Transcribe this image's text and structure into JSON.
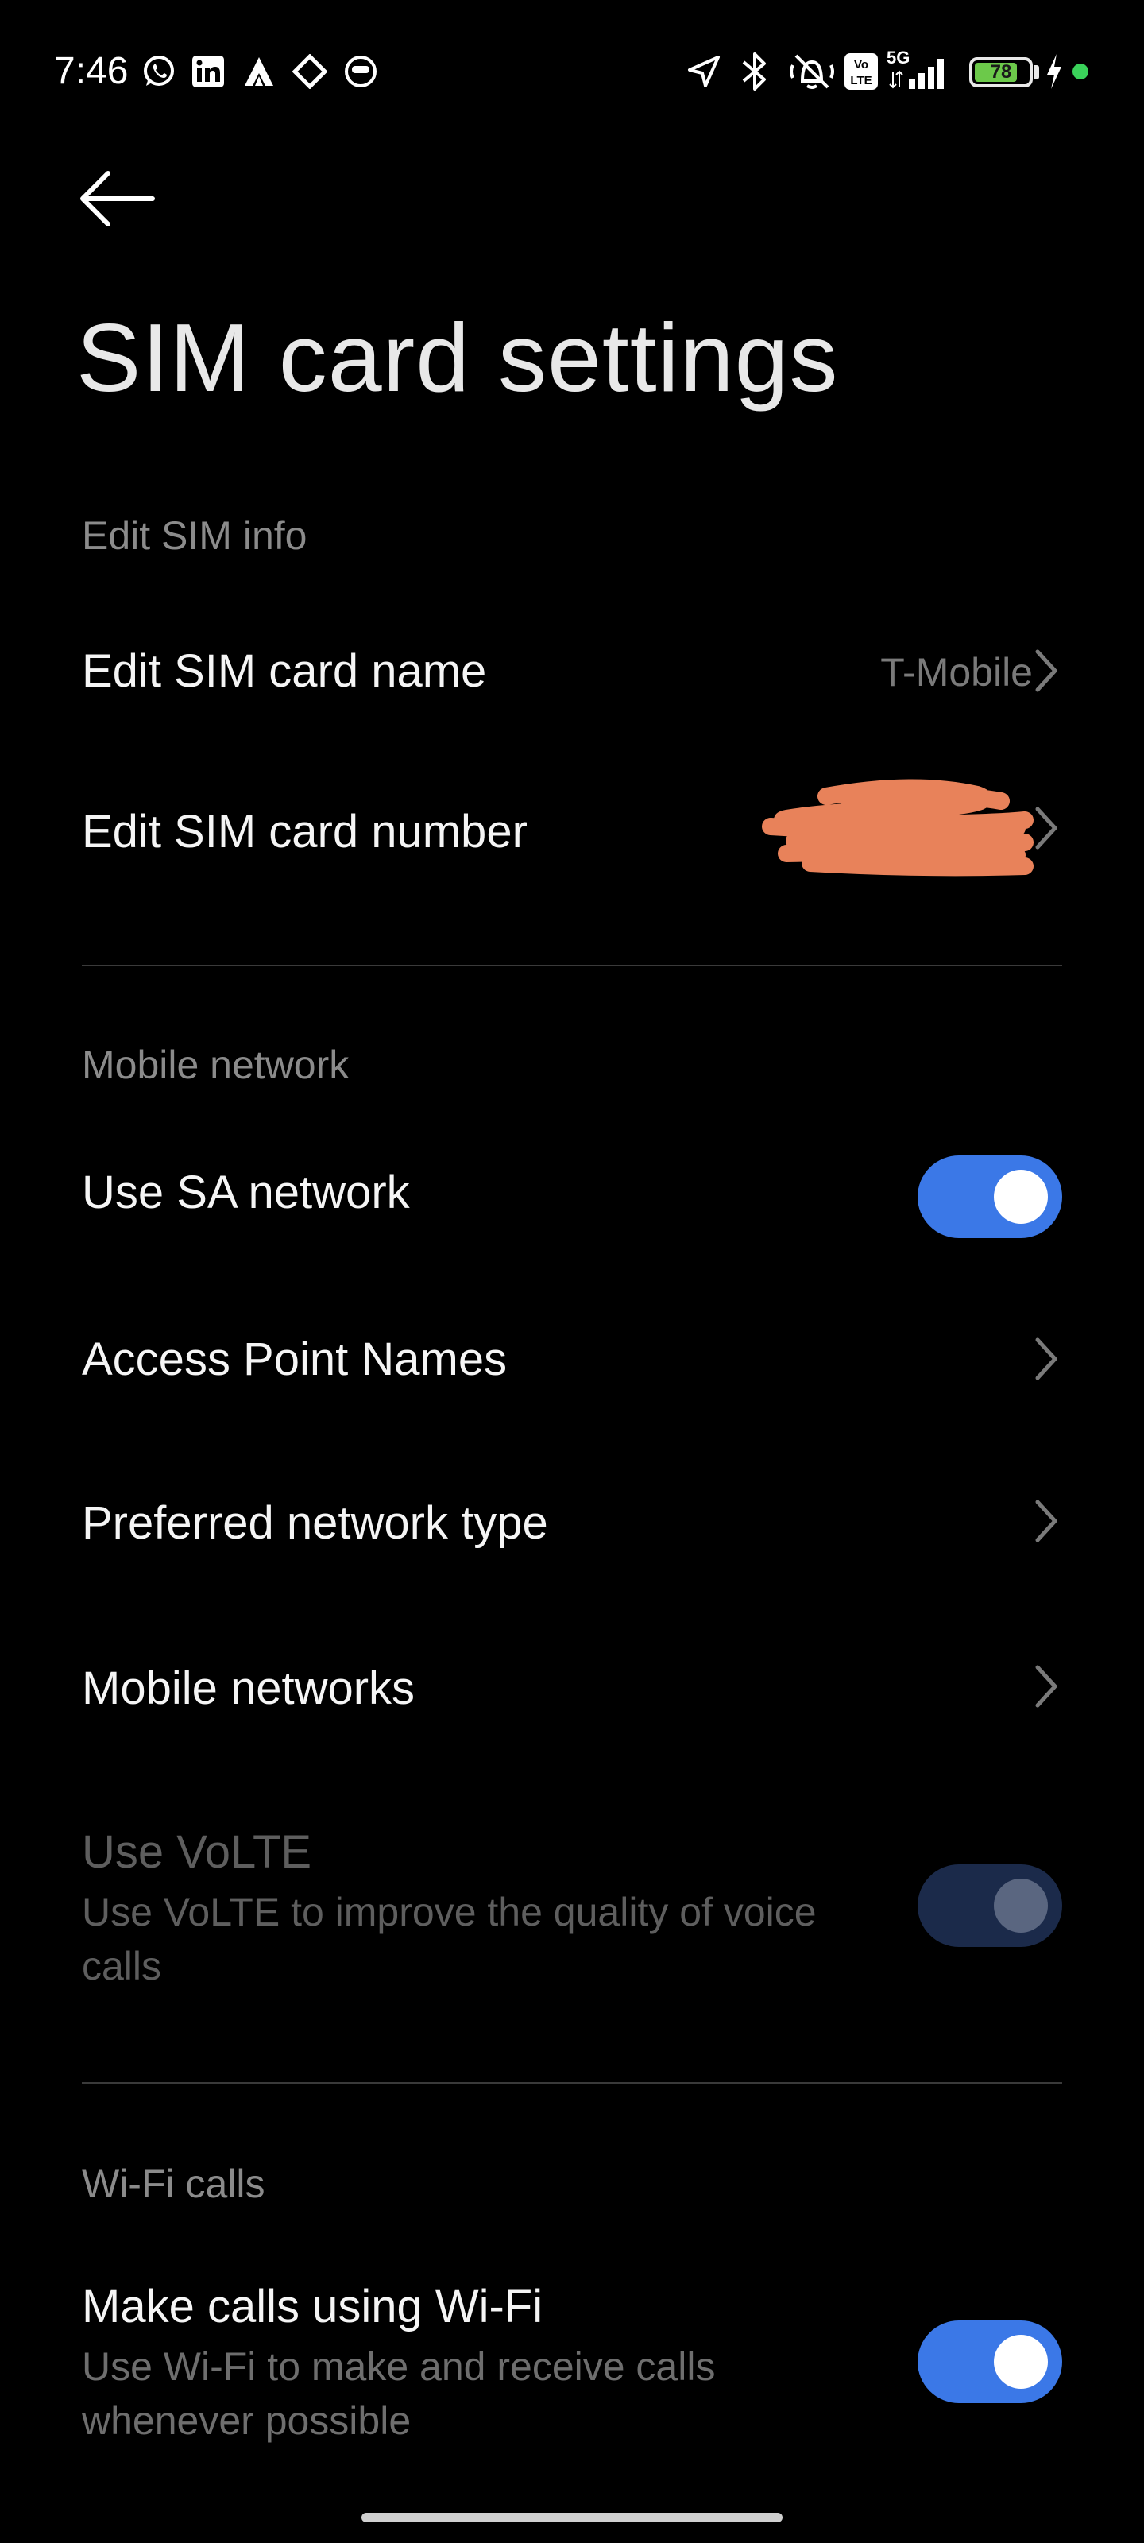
{
  "status_bar": {
    "time": "7:46",
    "left_icons": [
      "whatsapp-icon",
      "linkedin-icon",
      "app-triangle-icon",
      "app-diamond-icon",
      "app-face-icon"
    ],
    "right_icons": [
      "location-arrow-icon",
      "bluetooth-icon",
      "vibrate-mute-icon",
      "volte-icon",
      "signal-5g-icon",
      "battery-icon",
      "charging-icon"
    ],
    "network": "5G",
    "volte_badge": "Vo LTE",
    "battery_level": "78",
    "battery_color": "#6cc94a",
    "dot_color": "#3ad25a"
  },
  "header": {
    "title": "SIM card settings"
  },
  "sections": {
    "edit_sim_info": {
      "header": "Edit SIM info",
      "name_row": {
        "title": "Edit SIM card name",
        "value": "T-Mobile"
      },
      "number_row": {
        "title": "Edit SIM card number"
      }
    },
    "mobile_network": {
      "header": "Mobile network",
      "sa_network": {
        "title": "Use SA network",
        "enabled": true
      },
      "apn": {
        "title": "Access Point Names"
      },
      "preferred_type": {
        "title": "Preferred network type"
      },
      "mobile_networks": {
        "title": "Mobile networks"
      },
      "volte": {
        "title": "Use VoLTE",
        "subtitle": "Use VoLTE to improve the quality of voice calls",
        "enabled": true,
        "disabled": true
      }
    },
    "wifi_calls": {
      "header": "Wi-Fi calls",
      "make_calls": {
        "title": "Make calls using Wi-Fi",
        "subtitle": "Use Wi-Fi to make and receive calls whenever possible",
        "enabled": true
      }
    }
  },
  "colors": {
    "accent": "#3b78e7",
    "redaction": "#e8825a",
    "background": "#000000"
  }
}
